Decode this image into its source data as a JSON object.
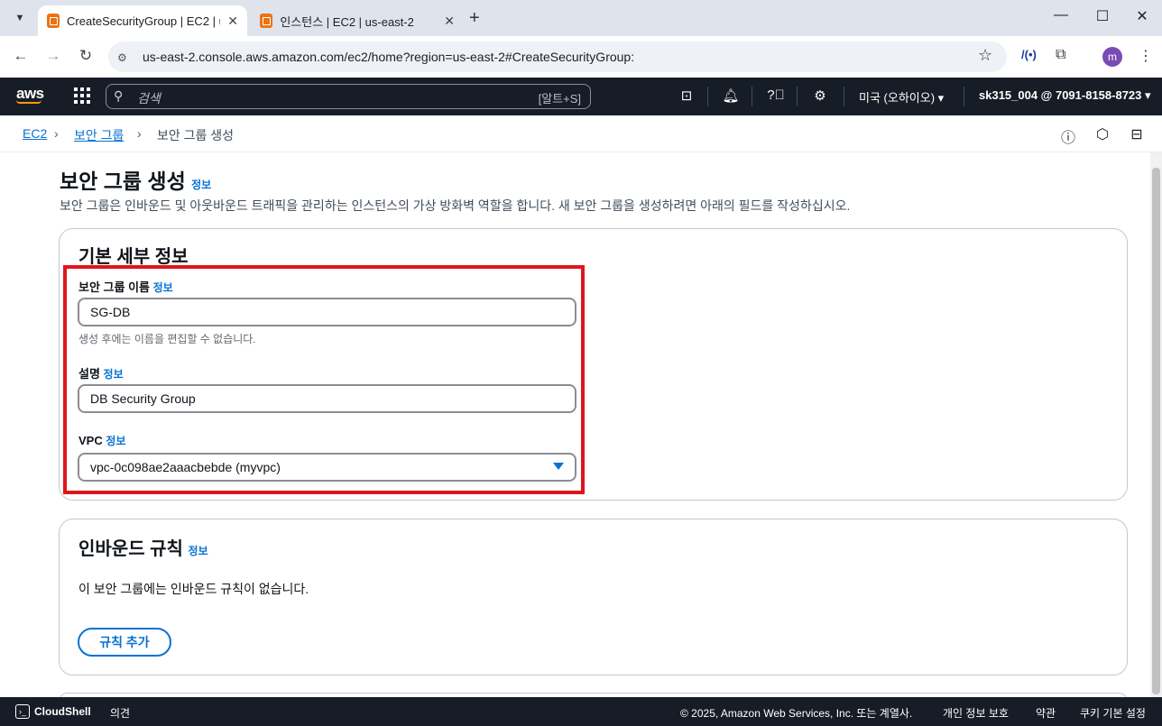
{
  "browser": {
    "tabs": [
      {
        "title": "CreateSecurityGroup | EC2 | us-east-2",
        "active": true
      },
      {
        "title": "인스턴스 | EC2 | us-east-2",
        "active": false
      }
    ],
    "url": "us-east-2.console.aws.amazon.com/ec2/home?region=us-east-2#CreateSecurityGroup:",
    "profile_initial": "m"
  },
  "aws_nav": {
    "logo": "aws",
    "search_placeholder": "검색",
    "search_shortcut": "[알트+S]",
    "region": "미국 (오하이오) ▾",
    "account": "sk315_004 @ 7091-8158-8723 ▾"
  },
  "breadcrumb": {
    "items": [
      "EC2",
      "보안 그룹",
      "보안 그룹 생성"
    ]
  },
  "page": {
    "title": "보안 그룹 생성",
    "info": "정보",
    "description": "보안 그룹은 인바운드 및 아웃바운드 트래픽을 관리하는 인스턴스의 가상 방화벽 역할을 합니다. 새 보안 그룹을 생성하려면 아래의 필드를 작성하십시오."
  },
  "basic_details": {
    "title": "기본 세부 정보",
    "name_label": "보안 그룹 이름",
    "name_value": "SG-DB",
    "name_hint": "생성 후에는 이름을 편집할 수 없습니다.",
    "desc_label": "설명",
    "desc_value": "DB Security Group",
    "vpc_label": "VPC",
    "vpc_value": "vpc-0c098ae2aaacbebde (myvpc)",
    "info": "정보"
  },
  "inbound": {
    "title": "인바운드 규칙",
    "info": "정보",
    "empty": "이 보안 그룹에는 인바운드 규칙이 없습니다.",
    "add_rule": "규칙 추가"
  },
  "footer": {
    "cloudshell": "CloudShell",
    "feedback": "의견",
    "copyright": "© 2025, Amazon Web Services, Inc. 또는 계열사.",
    "privacy": "개인 정보 보호",
    "terms": "약관",
    "cookies": "쿠키 기본 설정"
  },
  "colors": {
    "highlight": "#e0151c",
    "link": "#0972d3",
    "nav_bg": "#161d26"
  }
}
